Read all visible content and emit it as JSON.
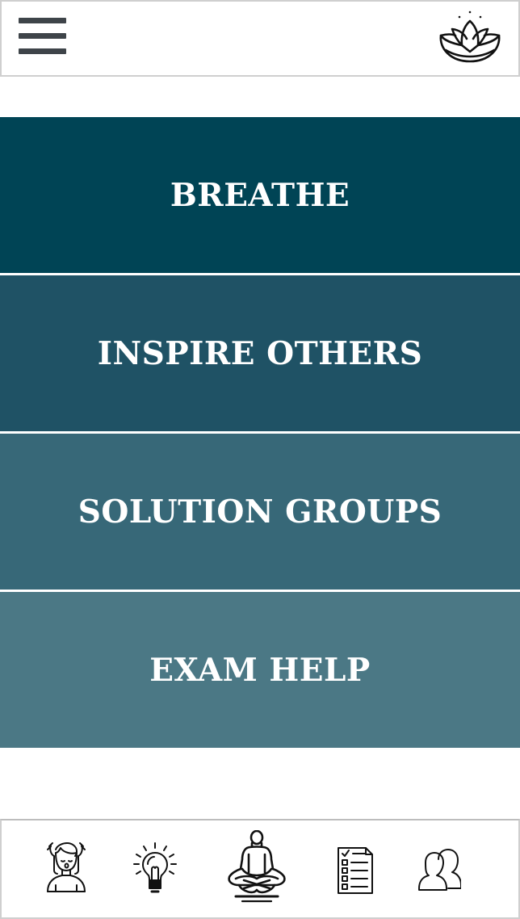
{
  "header": {
    "menu_icon": "hamburger-menu-icon",
    "logo_icon": "lotus-icon"
  },
  "menu": {
    "items": [
      {
        "label": "BREATHE",
        "color": "#004455"
      },
      {
        "label": "INSPIRE OTHERS",
        "color": "#1f5265"
      },
      {
        "label": "SOLUTION GROUPS",
        "color": "#376878"
      },
      {
        "label": "EXAM HELP",
        "color": "#4b7885"
      }
    ]
  },
  "bottom_nav": {
    "items": [
      {
        "icon": "relaxed-person-icon"
      },
      {
        "icon": "lightbulb-icon"
      },
      {
        "icon": "meditation-icon"
      },
      {
        "icon": "checklist-icon"
      },
      {
        "icon": "users-icon"
      }
    ]
  }
}
